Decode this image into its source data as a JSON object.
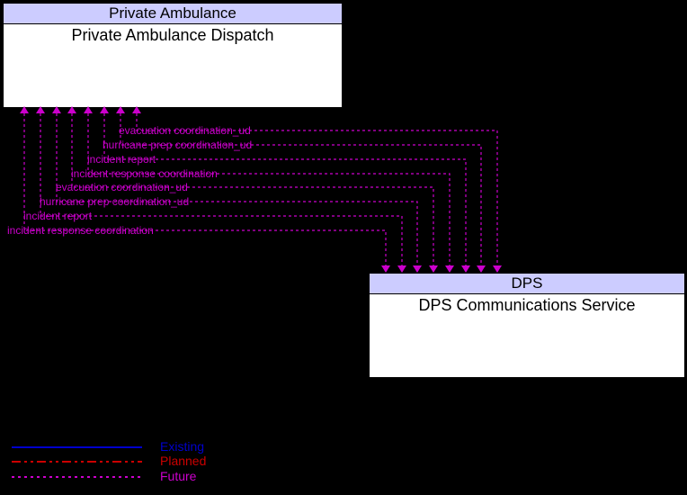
{
  "boxes": {
    "pa": {
      "header": "Private Ambulance",
      "title": "Private Ambulance Dispatch"
    },
    "dps": {
      "header": "DPS",
      "title": "DPS Communications Service"
    }
  },
  "flows": [
    {
      "label": "evacuation coordination_ud",
      "labelX": 128,
      "labelY": 145,
      "paYTop": 118,
      "paX": 152,
      "dpsX": 553,
      "dpsYTop": 303
    },
    {
      "label": "hurricane prep coordination_ud",
      "labelX": 110,
      "labelY": 161,
      "paYTop": 118,
      "paX": 134,
      "dpsX": 535,
      "dpsYTop": 303
    },
    {
      "label": "incident report",
      "labelX": 93,
      "labelY": 177,
      "paYTop": 118,
      "paX": 116,
      "dpsX": 518,
      "dpsYTop": 303
    },
    {
      "label": "incident response coordination",
      "labelX": 75,
      "labelY": 193,
      "paYTop": 118,
      "paX": 98,
      "dpsX": 500,
      "dpsYTop": 303
    },
    {
      "label": "evacuation coordination_ud",
      "labelX": 58,
      "labelY": 208,
      "paYTop": 118,
      "paX": 80,
      "dpsX": 482,
      "dpsYTop": 303
    },
    {
      "label": "hurricane prep coordination_ud",
      "labelX": 40,
      "labelY": 224,
      "paYTop": 118,
      "paX": 63,
      "dpsX": 464,
      "dpsYTop": 303
    },
    {
      "label": "incident report",
      "labelX": 22,
      "labelY": 240,
      "paYTop": 118,
      "paX": 45,
      "dpsX": 447,
      "dpsYTop": 303
    },
    {
      "label": "incident response coordination",
      "labelX": 4,
      "labelY": 256,
      "paYTop": 118,
      "paX": 27,
      "dpsX": 429,
      "dpsYTop": 303
    }
  ],
  "legend": {
    "existing": "Existing",
    "planned": "Planned",
    "future": "Future"
  },
  "colors": {
    "existing": "#0000cc",
    "planned": "#cc0000",
    "future": "#cc00cc"
  }
}
